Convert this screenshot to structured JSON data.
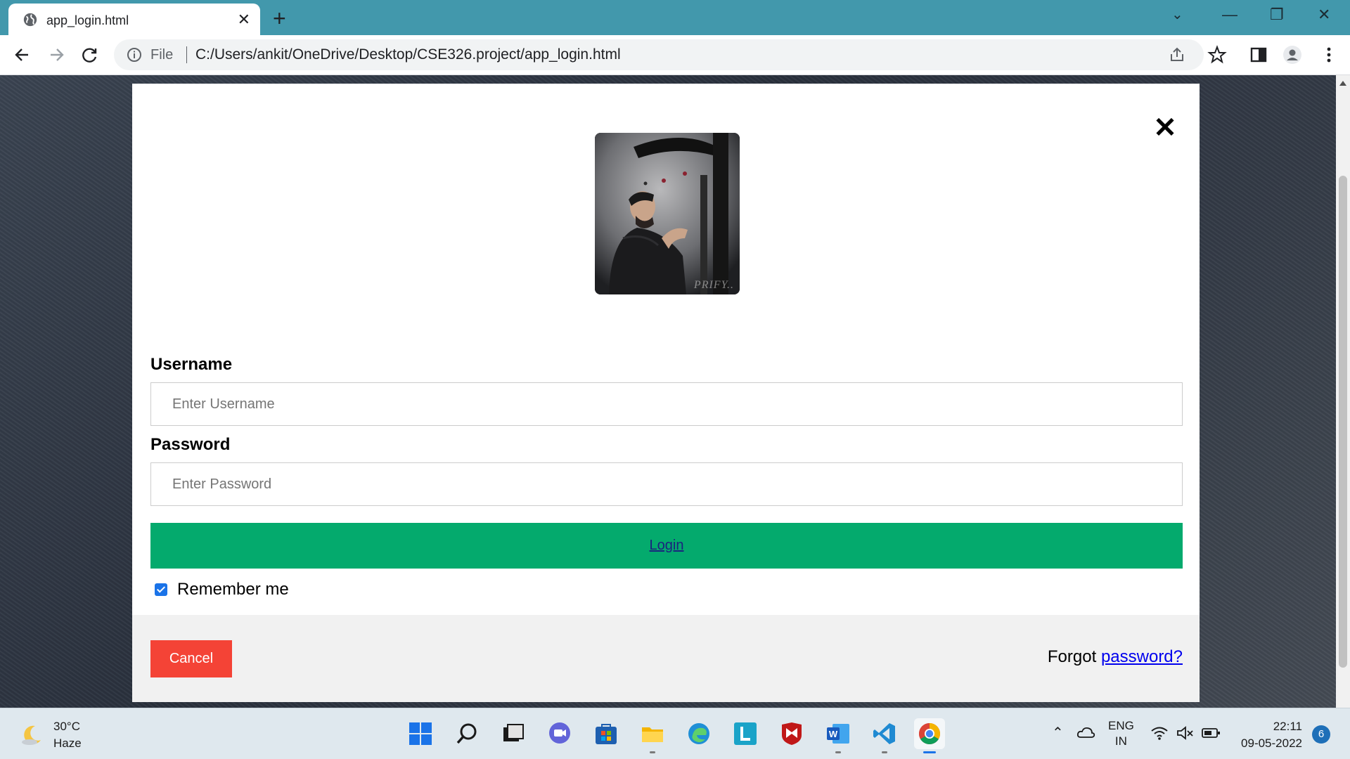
{
  "browser": {
    "tab_title": "app_login.html",
    "url_scheme": "File",
    "url": "C:/Users/ankit/OneDrive/Desktop/CSE326.project/app_login.html",
    "accent_color": "#4298ac"
  },
  "modal": {
    "close_symbol": "✕",
    "avatar_watermark": "PRIFY..",
    "username_label": "Username",
    "username_placeholder": "Enter Username",
    "password_label": "Password",
    "password_placeholder": "Enter Password",
    "login_label": "Login",
    "login_color": "#04aa6d",
    "remember_label": "Remember me",
    "remember_checked": true,
    "cancel_label": "Cancel",
    "cancel_color": "#f44336",
    "forgot_prefix": "Forgot",
    "forgot_link": "password?"
  },
  "taskbar": {
    "temperature": "30°C",
    "weather": "Haze",
    "language": "ENG",
    "region": "IN",
    "time": "22:11",
    "date": "09-05-2022",
    "notification_count": "6",
    "apps": [
      "start-icon",
      "search-icon",
      "task-view-icon",
      "chat-icon",
      "store-icon",
      "file-explorer-icon",
      "edge-icon",
      "l-app-icon",
      "mcafee-icon",
      "word-icon",
      "vscode-icon",
      "chrome-icon"
    ]
  }
}
